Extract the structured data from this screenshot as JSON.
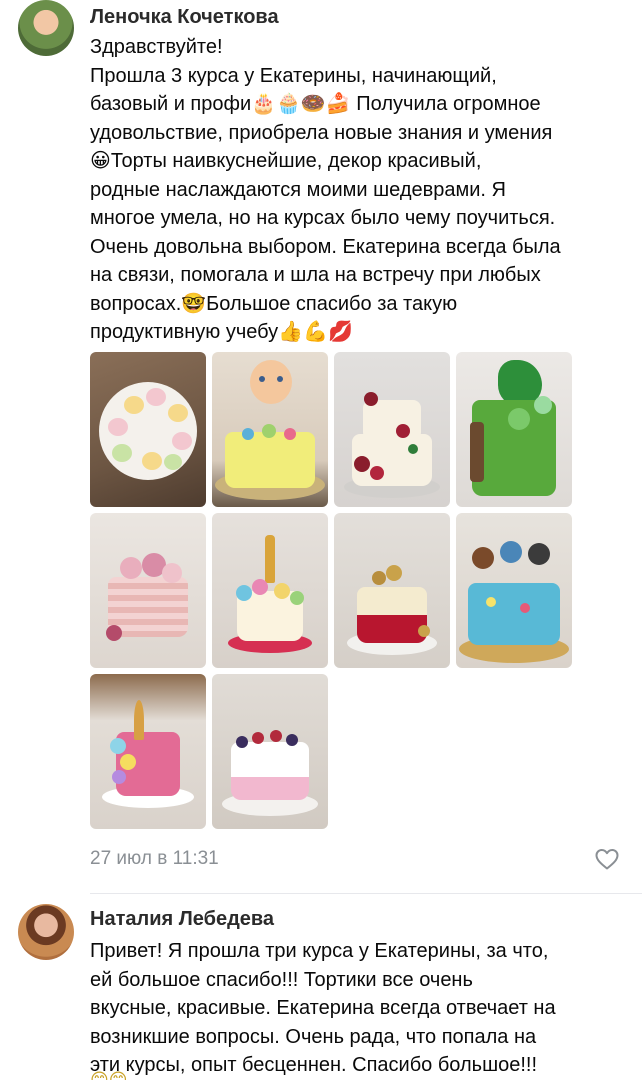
{
  "comments": [
    {
      "author": "Леночка Кочеткова",
      "lines": [
        "Здравствуйте!",
        "Прошла 3 курса у Екатерины, начинающий,",
        "базовый и профи🎂🧁🍩🍰 Получила огромное",
        "удовольствие, приобрела новые знания и умения",
        "😀Торты наивкуснейшие, декор красивый,",
        "родные наслаждаются моими шедеврами. Я",
        "многое умела, но на курсах было чему поучиться.",
        "Очень довольна выбором. Екатерина всегда была",
        "на связи, помогала и шла на встречу при любых",
        "вопросах.🤓Большое спасибо за такую",
        "продуктивную учебу👍💪💋"
      ],
      "timestamp": "27 июл в 11:31",
      "photos": [
        {
          "name": "photo-cake-1",
          "desc": "flower-cake"
        },
        {
          "name": "photo-cake-2",
          "desc": "baby-cake"
        },
        {
          "name": "photo-cake-3",
          "desc": "two-tier-berry-cake"
        },
        {
          "name": "photo-cake-4",
          "desc": "green-cake"
        },
        {
          "name": "photo-cake-5",
          "desc": "pink-flower-cake"
        },
        {
          "name": "photo-cake-6",
          "desc": "unicorn-cake"
        },
        {
          "name": "photo-cake-7",
          "desc": "red-gold-cake"
        },
        {
          "name": "photo-cake-8",
          "desc": "paw-patrol-cake"
        },
        {
          "name": "photo-cake-9",
          "desc": "pink-unicorn-cake"
        },
        {
          "name": "photo-cake-10",
          "desc": "berry-drip-cake"
        }
      ],
      "like_icon": "heart-outline-icon"
    },
    {
      "author": "Наталия Лебедева",
      "lines": [
        "Привет! Я прошла три курса у Екатерины, за что,",
        "ей большое спасибо!!! Тортики все очень",
        "вкусные, красивые. Екатерина всегда отвечает на",
        "возникшие вопросы. Очень рада, что попала на",
        "эти курсы, опыт бесценнен. Спасибо большое!!!"
      ],
      "trailing_emoji": "😊😊"
    }
  ],
  "colors": {
    "author": "#2b2b2b",
    "text": "#0a0a0a",
    "muted": "#8a8f94",
    "divider": "#e7e8ec"
  }
}
